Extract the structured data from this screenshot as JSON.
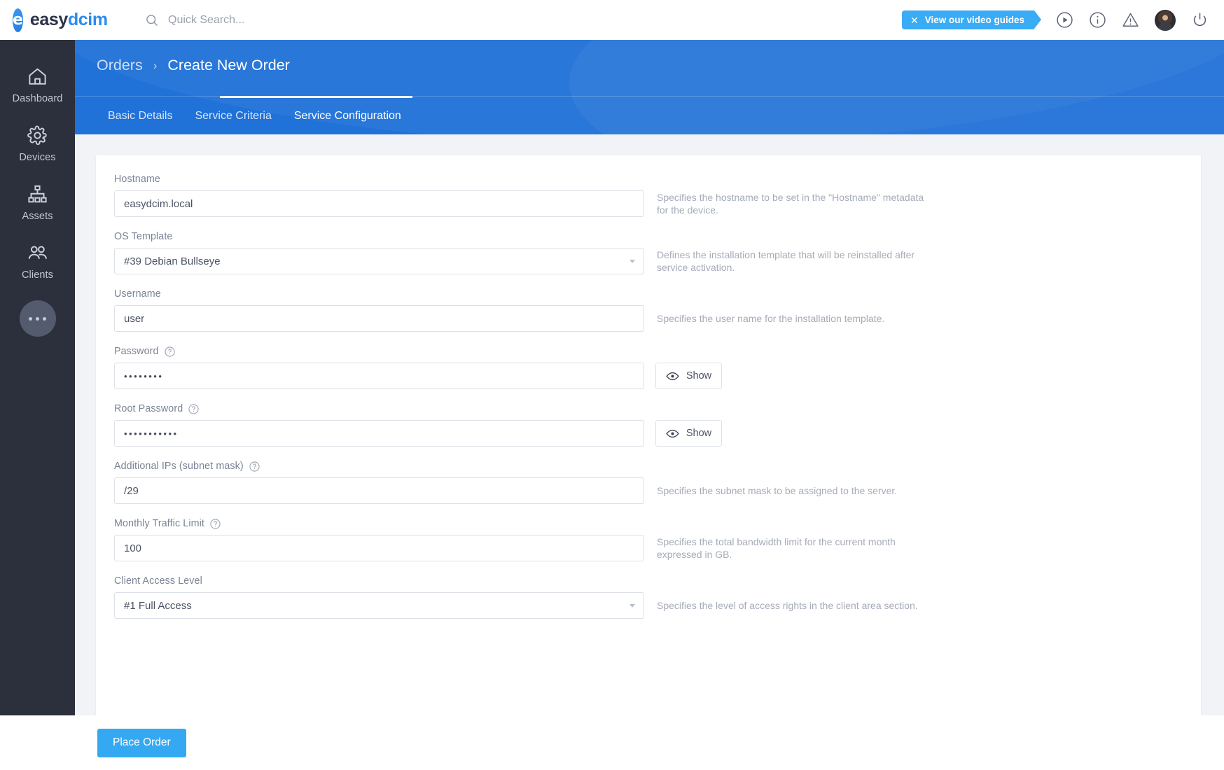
{
  "brand": {
    "name_part1": "easy",
    "name_part2": "dcim",
    "logo_glyph": "e"
  },
  "search": {
    "placeholder": "Quick Search...",
    "value": ""
  },
  "topbar": {
    "video_guides_label": "View our video guides",
    "close_glyph": "✕"
  },
  "sidebar": {
    "items": [
      {
        "label": "Dashboard",
        "icon": "home-icon"
      },
      {
        "label": "Devices",
        "icon": "gear-icon"
      },
      {
        "label": "Assets",
        "icon": "sitemap-icon"
      },
      {
        "label": "Clients",
        "icon": "users-icon"
      }
    ],
    "more_label": "more-options"
  },
  "header": {
    "breadcrumb_parent": "Orders",
    "breadcrumb_separator": "›",
    "breadcrumb_current": "Create New Order"
  },
  "tabs": [
    {
      "label": "Basic Details",
      "active": false
    },
    {
      "label": "Service Criteria",
      "active": false
    },
    {
      "label": "Service Configuration",
      "active": true
    }
  ],
  "form": {
    "fields": [
      {
        "label": "Hostname",
        "type": "text",
        "value": "easydcim.local",
        "help": "Specifies the hostname to be set in the \"Hostname\" metadata for the device.",
        "has_tooltip": false
      },
      {
        "label": "OS Template",
        "type": "select",
        "value": "#39 Debian Bullseye",
        "help": "Defines the installation template that will be reinstalled after service activation.",
        "has_tooltip": false
      },
      {
        "label": "Username",
        "type": "text",
        "value": "user",
        "help": "Specifies the user name for the installation template.",
        "has_tooltip": false
      },
      {
        "label": "Password",
        "type": "password",
        "value": "••••••••",
        "help": "",
        "has_tooltip": true,
        "show_button": "Show"
      },
      {
        "label": "Root Password",
        "type": "password",
        "value": "•••••••••••",
        "help": "",
        "has_tooltip": true,
        "show_button": "Show"
      },
      {
        "label": "Additional IPs (subnet mask)",
        "type": "text",
        "value": "/29",
        "help": "Specifies the subnet mask to be assigned to the server.",
        "has_tooltip": true
      },
      {
        "label": "Monthly Traffic Limit",
        "type": "text",
        "value": "100",
        "help": "Specifies the total bandwidth limit for the current month expressed in GB.",
        "has_tooltip": true
      },
      {
        "label": "Client Access Level",
        "type": "select",
        "value": "#1 Full Access",
        "help": "Specifies the level of access rights in the client area section.",
        "has_tooltip": false
      }
    ]
  },
  "footer": {
    "place_order_label": "Place Order"
  },
  "colors": {
    "accent_blue": "#34a9f2",
    "header_blue": "#2071d8",
    "sidebar_dark": "#2b303c",
    "page_bg": "#f1f3f6"
  }
}
